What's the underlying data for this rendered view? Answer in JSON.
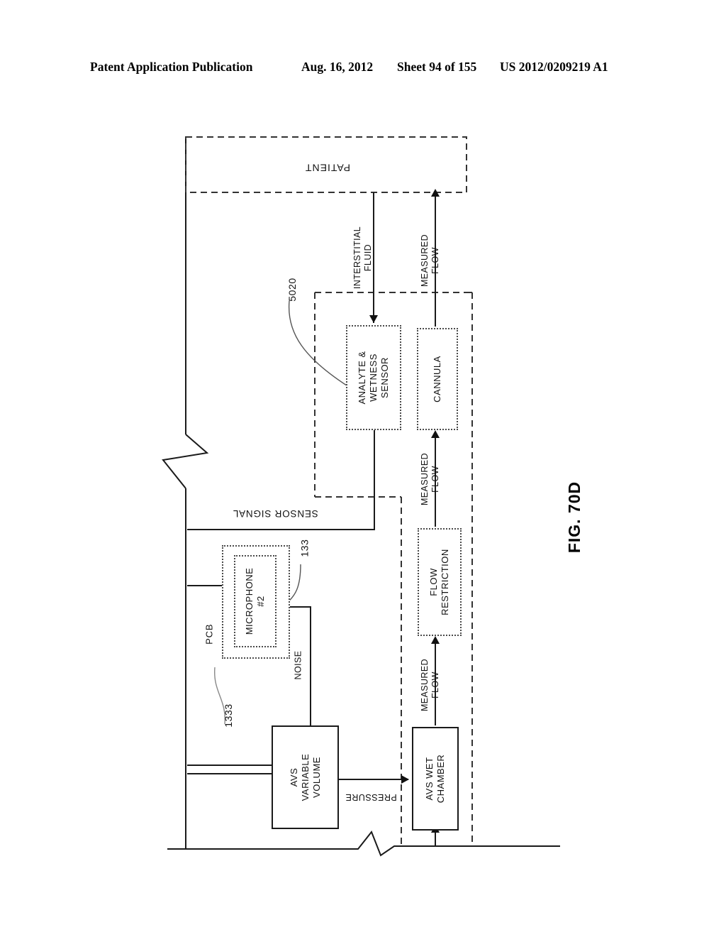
{
  "header": {
    "publication": "Patent Application Publication",
    "date": "Aug. 16, 2012",
    "sheet": "Sheet 94 of 155",
    "number": "US 2012/0209219 A1"
  },
  "figure": {
    "label": "FIG. 70D"
  },
  "blocks": {
    "patient": "PATIENT",
    "analyte_wetness_sensor": "ANALYTE &\nWETNESS\nSENSOR",
    "cannula": "CANNULA",
    "flow_restriction": "FLOW\nRESTRICTION",
    "avs_variable_volume": "AVS\nVARIABLE\nVOLUME",
    "avs_wet_chamber": "AVS WET\nCHAMBER",
    "microphone": "MICROPHONE\n#2",
    "pcb": "PCB"
  },
  "flow_labels": {
    "interstitial_fluid": "INTERSTITIAL\nFLUID",
    "measured_flow_patient": "MEASURED\nFLOW",
    "measured_flow_cannula": "MEASURED\nFLOW",
    "measured_flow_chamber": "MEASURED\nFLOW",
    "sensor_signal": "SENSOR SIGNAL",
    "noise": "NOISE",
    "pressure": "PRESSURE"
  },
  "reference_numerals": {
    "sensor_ref": "5020",
    "microphone_ref": "133",
    "pcb_ref": "1333"
  },
  "colors": {
    "ink": "#111111",
    "dotted_border": "#4a4a4a",
    "dashed_border": "#333333",
    "background": "#ffffff"
  }
}
